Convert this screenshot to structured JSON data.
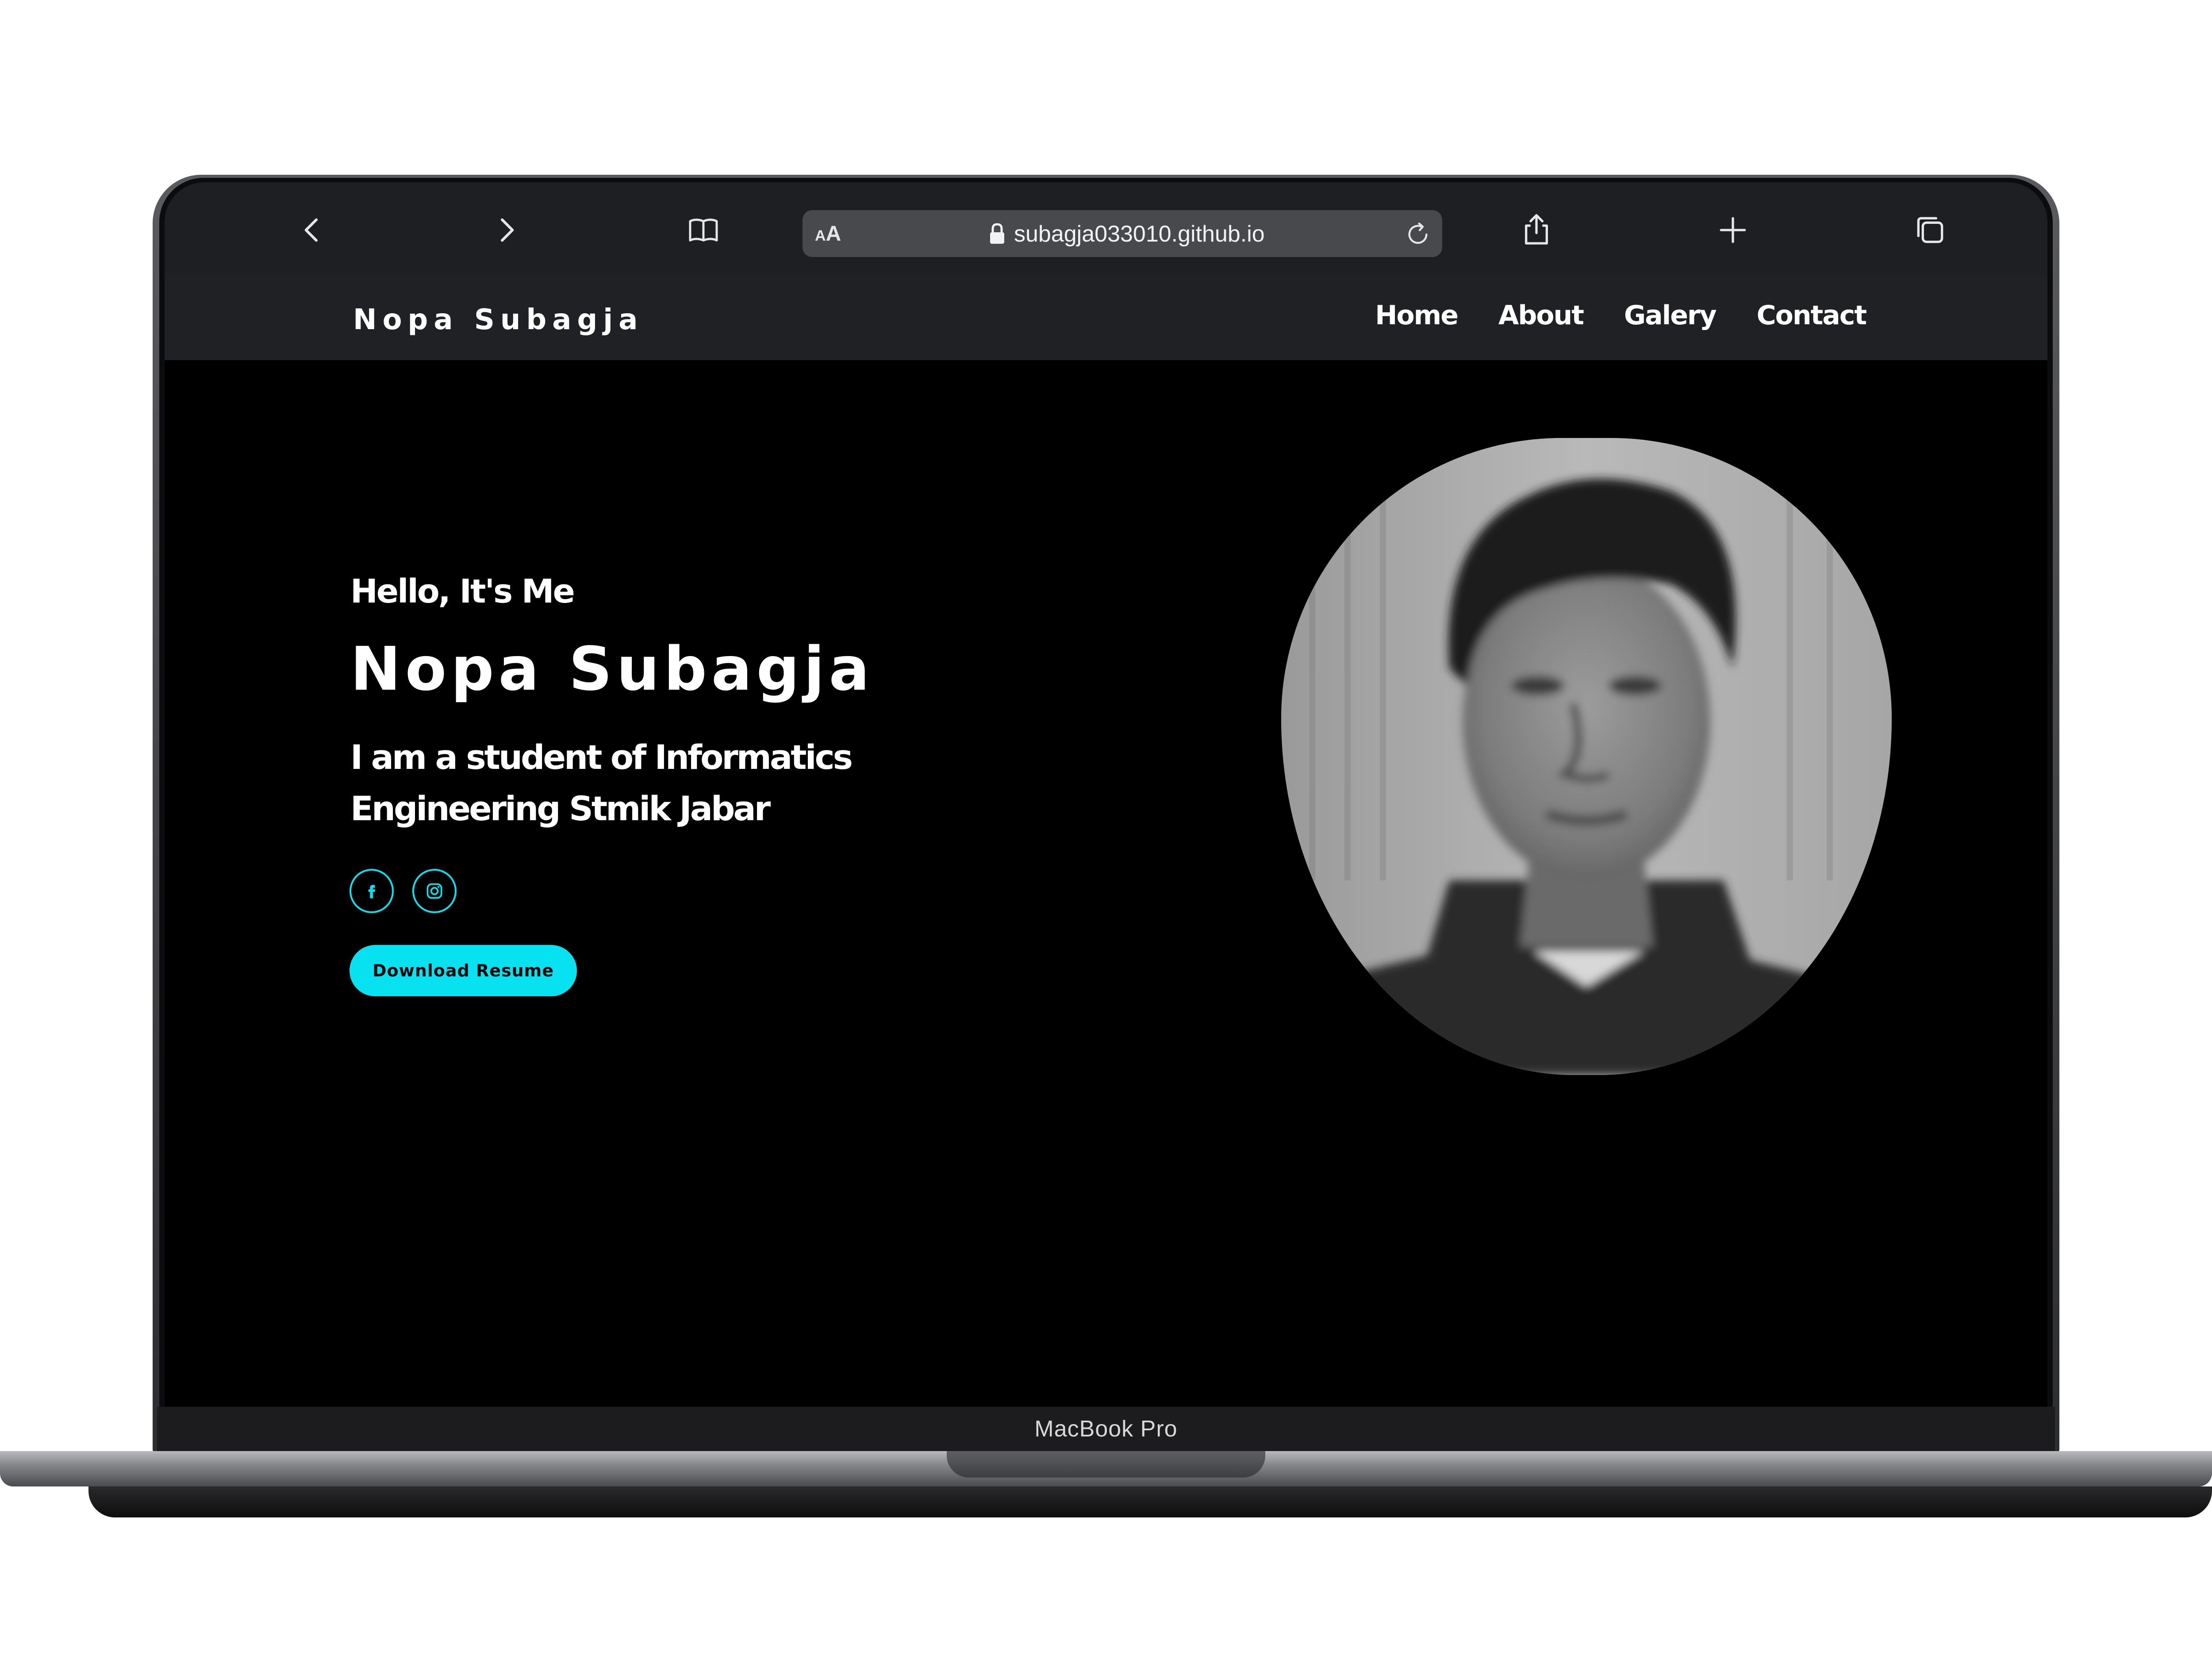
{
  "browser": {
    "text_size_label": "AA",
    "url": "subagja033010.github.io"
  },
  "site": {
    "logo": "Nopa Subagja",
    "nav": [
      "Home",
      "About",
      "Galery",
      "Contact"
    ]
  },
  "hero": {
    "greeting": "Hello, It's Me",
    "name": "Nopa Subagja",
    "description": "I am a student of Informatics Engineering Stmik Jabar",
    "download_label": "Download Resume"
  },
  "device": {
    "model_label": "MacBook Pro"
  },
  "colors": {
    "accent": "#08e2f0",
    "background": "#000000",
    "nav_background": "#202124",
    "toolbar_background": "#1e1f23"
  },
  "icons": {
    "toolbar": [
      "back-icon",
      "forward-icon",
      "bookmarks-icon",
      "share-icon",
      "new-tab-icon",
      "tabs-icon"
    ],
    "address_bar": [
      "lock-icon",
      "reload-icon"
    ],
    "social": [
      "facebook-icon",
      "instagram-icon"
    ]
  }
}
